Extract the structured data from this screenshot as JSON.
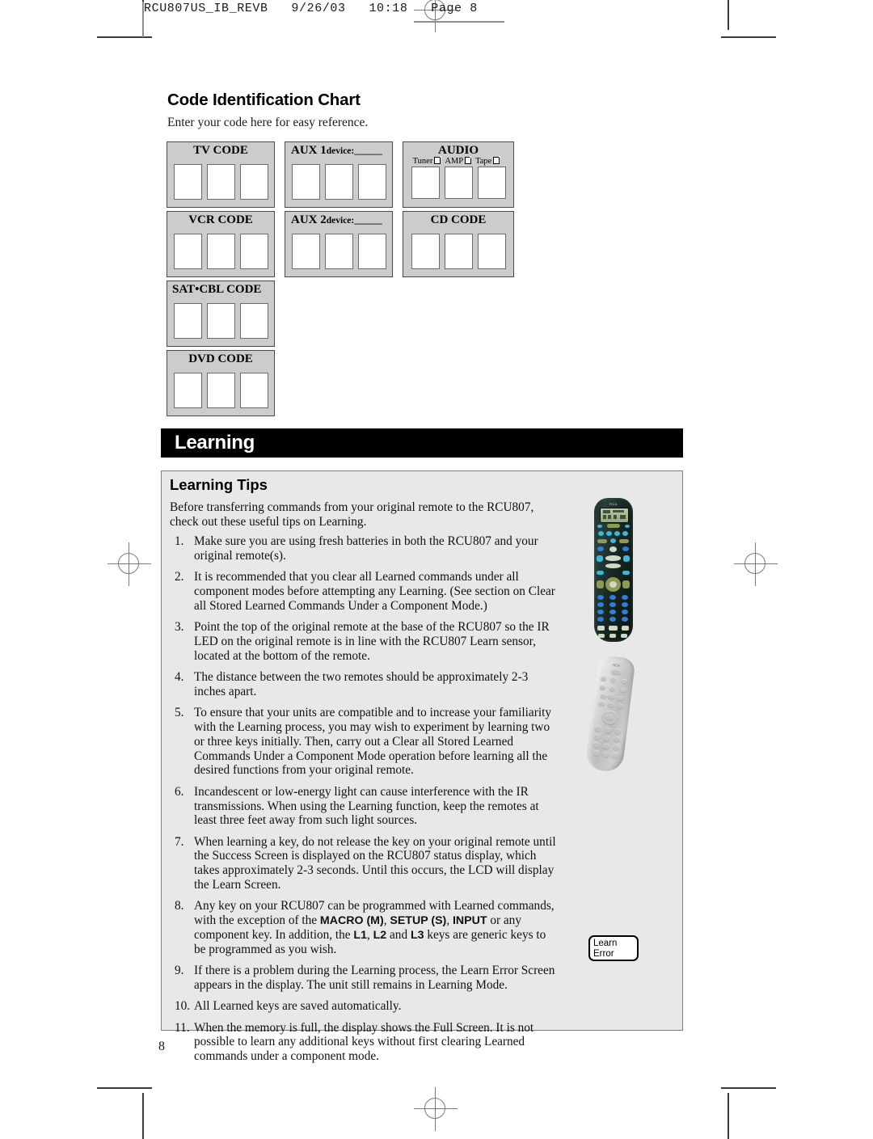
{
  "print_slug": "RCU807US_IB_REVB   9/26/03   10:18   Page 8",
  "page_number": "8",
  "code_chart": {
    "title": "Code Identification Chart",
    "subtitle": "Enter your code here for easy reference.",
    "boxes": [
      {
        "name": "tv-code",
        "label": "TV CODE",
        "sub": null,
        "cells": 3
      },
      {
        "name": "aux1-code",
        "label": "AUX 1",
        "suffix": "device:______",
        "sub": null,
        "cells": 3
      },
      {
        "name": "audio-code",
        "label": "AUDIO",
        "sub": "audio-options",
        "cells": 3
      },
      {
        "name": "vcr-code",
        "label": "VCR CODE",
        "sub": null,
        "cells": 3
      },
      {
        "name": "aux2-code",
        "label": "AUX 2",
        "suffix": "device:______",
        "sub": null,
        "cells": 3
      },
      {
        "name": "cd-code",
        "label": "CD CODE",
        "sub": null,
        "cells": 3
      },
      {
        "name": "satcbl-code",
        "label": "SAT•CBL CODE",
        "sub": null,
        "cells": 3
      },
      {
        "name": "dvd-code",
        "label": "DVD CODE",
        "sub": null,
        "cells": 3
      }
    ],
    "audio_options": [
      "Tuner",
      "AMP",
      "Tape"
    ]
  },
  "section": {
    "banner_title": "Learning",
    "panel_title": "Learning Tips",
    "intro": "Before transferring commands from your original remote to the RCU807, check out these useful tips on Learning.",
    "tips": [
      {
        "num": "1.",
        "text": "Make sure you are using fresh batteries in both the RCU807 and your original remote(s)."
      },
      {
        "num": "2.",
        "text": "It is recommended that you clear all Learned commands under all component modes before attempting any Learning. (See section on Clear all Stored Learned Commands Under a Component Mode.)"
      },
      {
        "num": "3.",
        "text": "Point the top of the original remote at the base of the RCU807 so the IR LED on the original remote is in line with the RCU807 Learn sensor, located at the bottom of the remote."
      },
      {
        "num": "4.",
        "text": "The distance between the two remotes should be approximately 2-3 inches apart."
      },
      {
        "num": "5.",
        "text": "To ensure that your units are compatible and to increase your familiarity with the Learning process, you may wish to experiment by learning two or three keys initially. Then, carry out a Clear all Stored Learned Commands Under a Component Mode operation before learning all the desired functions from your original remote."
      },
      {
        "num": "6.",
        "text": "Incandescent or low-energy light can cause interference with the IR transmissions. When using the Learning function, keep the remotes at least three feet away from such light sources."
      },
      {
        "num": "7.",
        "text": "When learning a key, do not release the key on your original remote until the Success Screen is displayed on the RCU807 status display, which takes approximately 2-3 seconds. Until this occurs, the LCD will display the Learn Screen."
      },
      {
        "num": "8.",
        "text": "Any key on your RCU807 can be programmed with Learned commands, with the exception of the ",
        "bold1": "MACRO (M)",
        "mid1": ", ",
        "bold2": "SETUP (S)",
        "mid2": ", ",
        "bold3": "INPUT",
        "mid3": " or any component key. In addition, the ",
        "bold4": "L1",
        "mid4": ", ",
        "bold5": "L2",
        "mid5": " and ",
        "bold6": "L3",
        "tail": " keys are generic keys to be programmed as you wish."
      },
      {
        "num": "9.",
        "text": "If there is a problem during the Learning process, the Learn Error Screen appears in the display. The unit still remains in Learning Mode."
      },
      {
        "num": "10.",
        "text": "All Learned keys are saved automatically."
      },
      {
        "num": "11.",
        "text": "When the memory is full, the display shows the Full Screen. It is not possible to learn any additional keys without first clearing Learned commands under a component mode."
      }
    ]
  },
  "illustrations": {
    "remote_dark_brand": "RCA",
    "remote_silver_brand": "RCA",
    "lcd_error_line1": "Learn",
    "lcd_error_line2": "Error"
  },
  "colors": {
    "banner_bg": "#000000",
    "panel_bg": "#e8e8e8",
    "code_box_bg": "#cccccc",
    "cell_bg": "#ffffff"
  }
}
